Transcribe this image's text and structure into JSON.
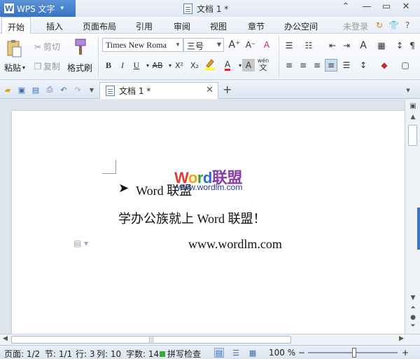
{
  "app": {
    "name": "WPS 文字",
    "caret": "▾"
  },
  "document": {
    "title": "文档 1 *"
  },
  "window": {
    "minimize": "⌃",
    "restore": "—",
    "maximize": "▭",
    "close": "✕"
  },
  "menu": {
    "items": [
      "开始",
      "插入",
      "页面布局",
      "引用",
      "审阅",
      "视图",
      "章节",
      "办公空间"
    ],
    "login": "未登录"
  },
  "ribbon": {
    "paste": "粘贴",
    "paste_caret": "▾",
    "cut": "剪切",
    "copy": "复制",
    "format_painter": "格式刷",
    "font_name": "Times New Roma",
    "font_size": "三号",
    "grow_font": "A⁺",
    "shrink_font": "A⁻",
    "clear_format": "A",
    "bold": "B",
    "italic": "I",
    "underline": "U",
    "strike": "AB",
    "superscript": "X²",
    "subscript": "X₂",
    "font_color": "A",
    "char_shading": "A",
    "pinyin_top": "wén",
    "pinyin_bottom": "文"
  },
  "tabs": {
    "active": "文档 1 *",
    "close": "✕",
    "add": "+"
  },
  "content": {
    "watermark_w": "W",
    "watermark_o": "o",
    "watermark_r": "r",
    "watermark_d": "d",
    "watermark_cn": "联盟",
    "watermark_url": "www.wordlm.com",
    "bullet": "➤",
    "line1": "Word 联盟",
    "line2": "学办公族就上 Word 联盟！",
    "line3": "www.wordlm.com"
  },
  "status": {
    "page": "页面: 1/2",
    "section": "节: 1/1",
    "row": "行: 3",
    "col": "列: 10",
    "words": "字数: 14",
    "spell": "拼写检查",
    "zoom": "100 %",
    "zoom_minus": "−",
    "zoom_plus": "+",
    "zoom_level": 1.0
  }
}
